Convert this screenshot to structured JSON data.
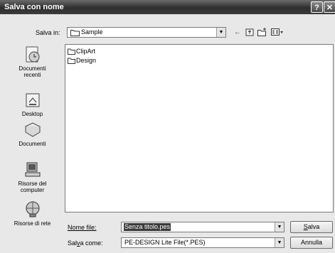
{
  "window": {
    "title": "Salva con nome",
    "help_glyph": "?",
    "close_glyph": "✕"
  },
  "save_in": {
    "label": "Salva in:",
    "selected_folder": "Sample",
    "dropdown_glyph": "▼"
  },
  "toolbar": {
    "back_icon": "←",
    "up_icon": "⬆",
    "new_folder_icon": "new-folder",
    "view_menu_icon": "view-menu"
  },
  "places_bar": [
    {
      "label_line1": "Documenti",
      "label_line2": "recenti",
      "icon": "recent-documents-icon"
    },
    {
      "label_line1": "Desktop",
      "label_line2": "",
      "icon": "desktop-icon"
    },
    {
      "label_line1": "Documenti",
      "label_line2": "",
      "icon": "my-documents-icon"
    },
    {
      "label_line1": "Risorse del",
      "label_line2": "computer",
      "icon": "my-computer-icon"
    },
    {
      "label_line1": "Risorse di rete",
      "label_line2": "",
      "icon": "network-places-icon"
    }
  ],
  "file_list": {
    "items": [
      "ClipArt",
      "Design"
    ]
  },
  "file_name": {
    "label": "Nome file:",
    "value": "Senza titolo.pes"
  },
  "save_as_type": {
    "label_pre": "Sal",
    "label_accel": "v",
    "label_post": "a come:",
    "value": "PE-DESIGN Lite File(*.PES)"
  },
  "buttons": {
    "save_accel": "S",
    "save_rest": "alva",
    "cancel": "Annulla"
  }
}
